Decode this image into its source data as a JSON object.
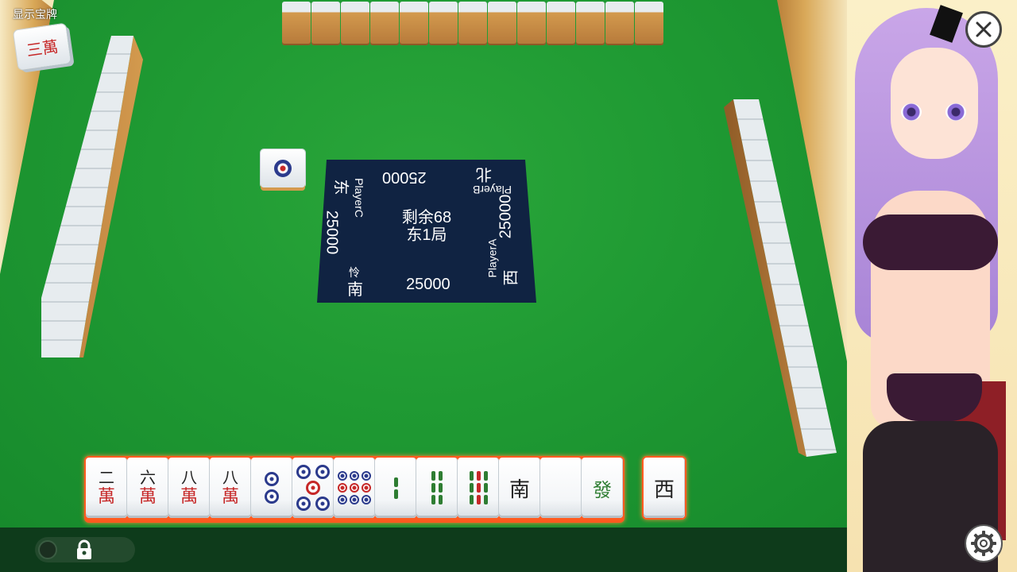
{
  "hud": {
    "dora_label": "显示宝牌",
    "dora_tile": "三萬"
  },
  "center": {
    "remaining": "剩余68",
    "round": "东1局"
  },
  "players": {
    "bottom": {
      "name": "怜",
      "wind": "南",
      "score": "25000"
    },
    "top": {
      "name": "PlayerB",
      "wind": "北",
      "score": "25000"
    },
    "left": {
      "name": "PlayerC",
      "wind": "东",
      "score": "25000"
    },
    "right": {
      "name": "PlayerA",
      "wind": "西",
      "score": "25000"
    }
  },
  "hand": [
    {
      "kind": "wan",
      "num": "二",
      "suit": "萬"
    },
    {
      "kind": "wan",
      "num": "六",
      "suit": "萬"
    },
    {
      "kind": "wan",
      "num": "八",
      "suit": "萬"
    },
    {
      "kind": "wan",
      "num": "八",
      "suit": "萬"
    },
    {
      "kind": "pin",
      "count": 2
    },
    {
      "kind": "pin",
      "count": 5
    },
    {
      "kind": "pin",
      "count": 9
    },
    {
      "kind": "sou",
      "count": 2
    },
    {
      "kind": "sou",
      "count": 6
    },
    {
      "kind": "sou",
      "count": 9
    },
    {
      "kind": "wind",
      "char": "南"
    },
    {
      "kind": "white",
      "char": ""
    },
    {
      "kind": "green",
      "char": "發"
    }
  ],
  "drawn_tile": {
    "kind": "wind",
    "char": "西"
  },
  "colors": {
    "felt": "#1f9a33",
    "panel": "#102342",
    "highlight": "#ff5a1f",
    "red_ink": "#c62828",
    "green_ink": "#2e7d32",
    "blue_ink": "#2b3a8c"
  },
  "icons": {
    "close": "close-icon",
    "settings": "gear-icon",
    "lock": "lock-icon"
  }
}
